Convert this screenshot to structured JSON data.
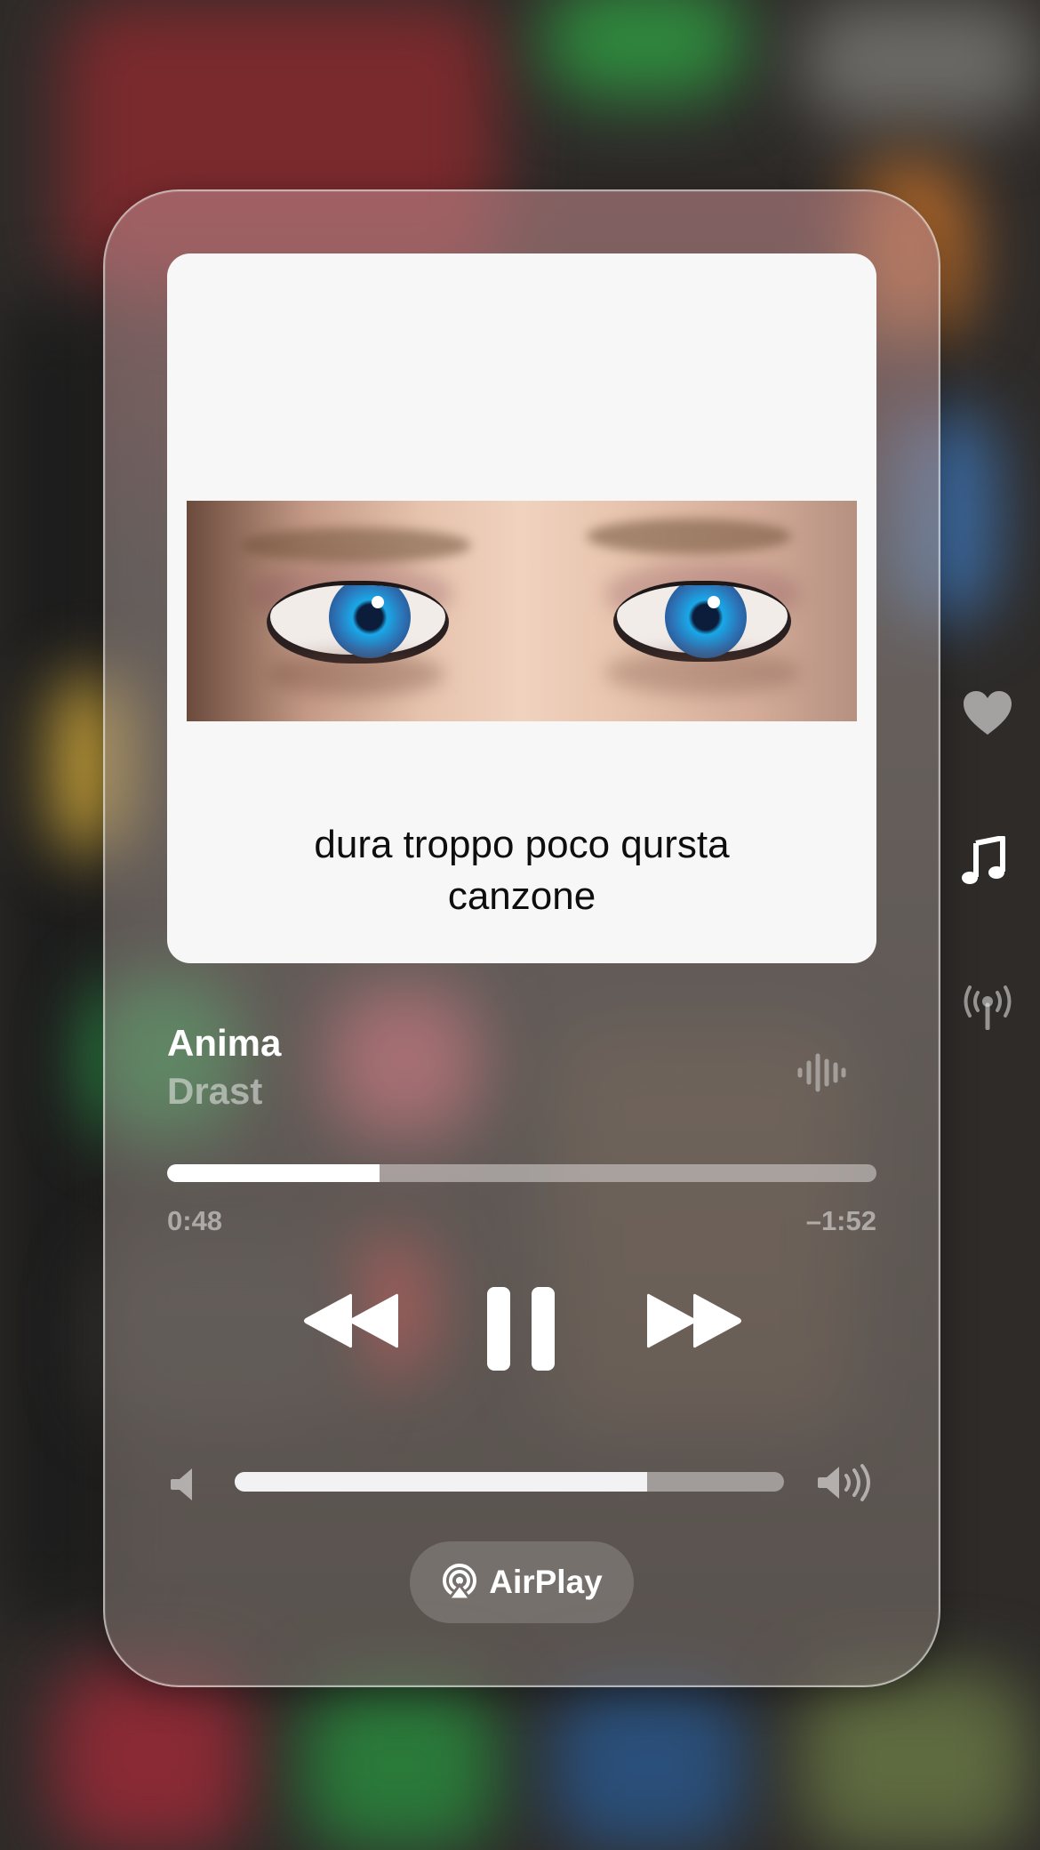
{
  "now_playing": {
    "artwork_caption": "dura troppo poco qursta canzone",
    "title": "Anima",
    "artist": "Drast",
    "elapsed": "0:48",
    "remaining": "–1:52",
    "progress": 0.3,
    "volume": 0.75,
    "airplay_label": "AirPlay"
  },
  "icons": {
    "waveform": "waveform-icon",
    "rewind": "backward-icon",
    "pause": "pause-icon",
    "forward": "forward-icon",
    "volume_low": "speaker-icon",
    "volume_high": "speaker-wave-icon",
    "airplay": "airplay-icon",
    "heart": "heart-icon",
    "music": "music-note-icon",
    "antenna": "antenna-icon"
  },
  "colors": {
    "primary": "#ffffff",
    "secondary": "#b9b3b1",
    "track": "#d9d3d2"
  }
}
